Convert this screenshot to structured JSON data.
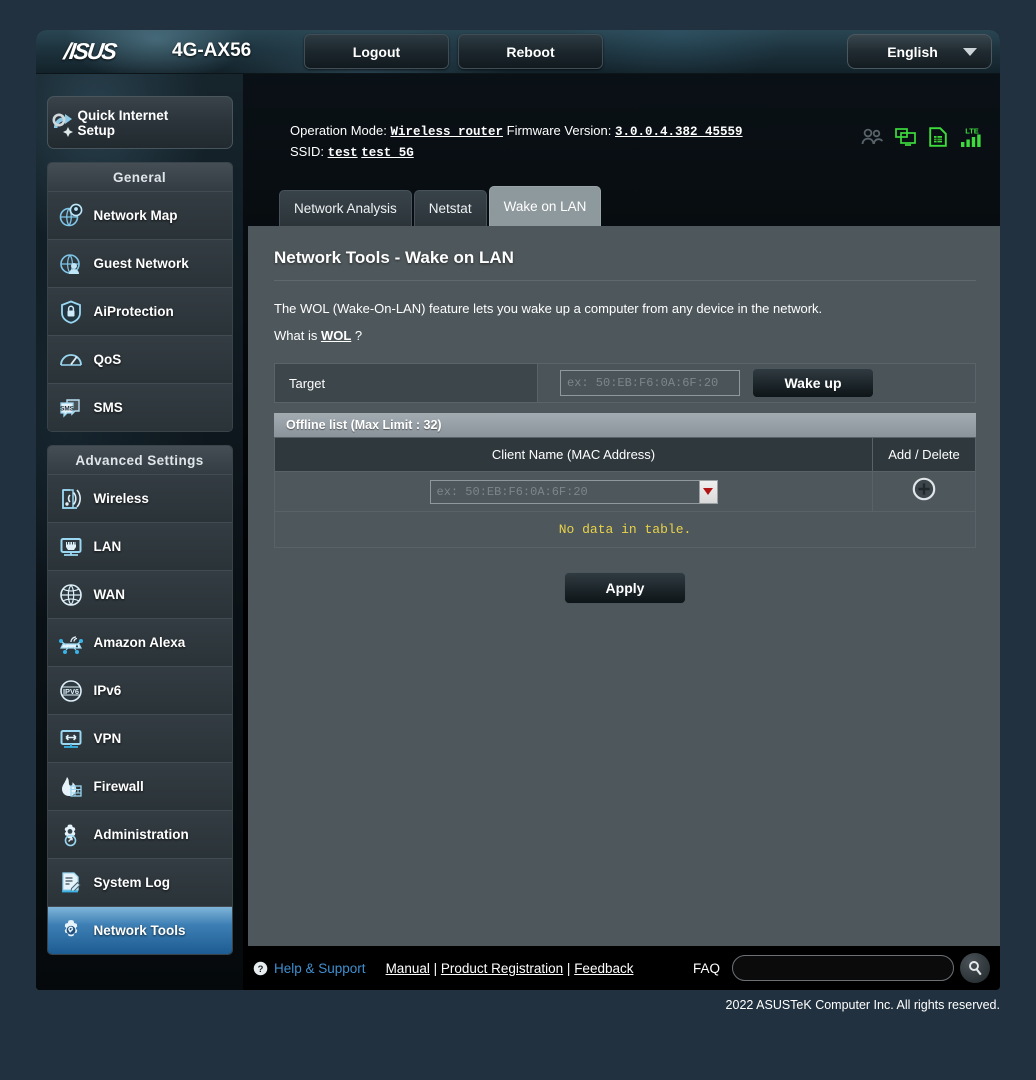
{
  "banner": {
    "logo": "/ISUS",
    "model": "4G-AX56",
    "logout_label": "Logout",
    "reboot_label": "Reboot",
    "language": "English"
  },
  "header_info": {
    "operation_mode_label": "Operation Mode:",
    "operation_mode_value": "Wireless router",
    "firmware_label": "Firmware Version:",
    "firmware_value": "3.0.0.4.382_45559",
    "ssid_label": "SSID:",
    "ssid_value_1": "test",
    "ssid_value_2": "test_5G"
  },
  "status_icons": [
    {
      "name": "clients-icon",
      "state": "inactive",
      "color": "#4f5a5f"
    },
    {
      "name": "usb-devices-icon",
      "state": "active",
      "color": "#3ddb3d"
    },
    {
      "name": "sim-card-icon",
      "state": "active",
      "color": "#3ddb3d"
    },
    {
      "name": "lte-signal-icon",
      "state": "active",
      "color": "#3ddb3d",
      "label": "LTE"
    }
  ],
  "sidebar": {
    "quick_internet_setup": "Quick Internet\nSetup",
    "quick_internet_setup_line1": "Quick Internet",
    "quick_internet_setup_line2": "Setup",
    "general_title": "General",
    "general_items": [
      {
        "label": "Network Map",
        "icon": "network-map-icon",
        "active": false
      },
      {
        "label": "Guest Network",
        "icon": "guest-network-icon",
        "active": false
      },
      {
        "label": "AiProtection",
        "icon": "aiprotection-icon",
        "active": false
      },
      {
        "label": "QoS",
        "icon": "qos-icon",
        "active": false
      },
      {
        "label": "SMS",
        "icon": "sms-icon",
        "active": false
      }
    ],
    "advanced_title": "Advanced Settings",
    "advanced_items": [
      {
        "label": "Wireless",
        "icon": "wireless-icon",
        "active": false
      },
      {
        "label": "LAN",
        "icon": "lan-icon",
        "active": false
      },
      {
        "label": "WAN",
        "icon": "wan-icon",
        "active": false
      },
      {
        "label": "Amazon Alexa",
        "icon": "alexa-icon",
        "active": false
      },
      {
        "label": "IPv6",
        "icon": "ipv6-icon",
        "active": false
      },
      {
        "label": "VPN",
        "icon": "vpn-icon",
        "active": false
      },
      {
        "label": "Firewall",
        "icon": "firewall-icon",
        "active": false
      },
      {
        "label": "Administration",
        "icon": "administration-icon",
        "active": false
      },
      {
        "label": "System Log",
        "icon": "system-log-icon",
        "active": false
      },
      {
        "label": "Network Tools",
        "icon": "network-tools-icon",
        "active": true
      }
    ]
  },
  "tabs": [
    {
      "label": "Network Analysis",
      "active": false
    },
    {
      "label": "Netstat",
      "active": false
    },
    {
      "label": "Wake on LAN",
      "active": true
    }
  ],
  "main": {
    "title": "Network Tools - Wake on LAN",
    "description": "The WOL (Wake-On-LAN) feature lets you wake up a computer from any device in the network.",
    "whatis_prefix": "What is ",
    "whatis_link": "WOL",
    "whatis_suffix": " ?",
    "target_label": "Target",
    "target_placeholder": "ex: 50:EB:F6:0A:6F:20",
    "target_value": "",
    "wake_up_label": "Wake up",
    "offline_list_title": "Offline list (Max Limit : 32)",
    "table_headers": [
      "Client Name (MAC Address)",
      "Add / Delete"
    ],
    "client_select_placeholder": "ex: 50:EB:F6:0A:6F:20",
    "client_select_value": "",
    "add_icon": "plus-circle-icon",
    "dropdown_icon": "chevron-down-icon",
    "no_data_text": "No data in table.",
    "apply_label": "Apply"
  },
  "footer": {
    "help_label": "Help & Support",
    "manual": "Manual",
    "separator": " | ",
    "product_registration": "Product Registration",
    "feedback": "Feedback",
    "faq_label": "FAQ",
    "faq_placeholder": "",
    "faq_value": "",
    "search_icon": "search-icon",
    "copyright": "2022 ASUSTeK Computer Inc. All rights reserved."
  },
  "colors": {
    "accent_blue": "#3f8fd0",
    "panel_gray": "#4e575b",
    "active_menu": "#1d5c92",
    "warn_yellow": "#e8d24a",
    "status_green": "#3ddb3d",
    "red_arrow": "#b01414"
  }
}
